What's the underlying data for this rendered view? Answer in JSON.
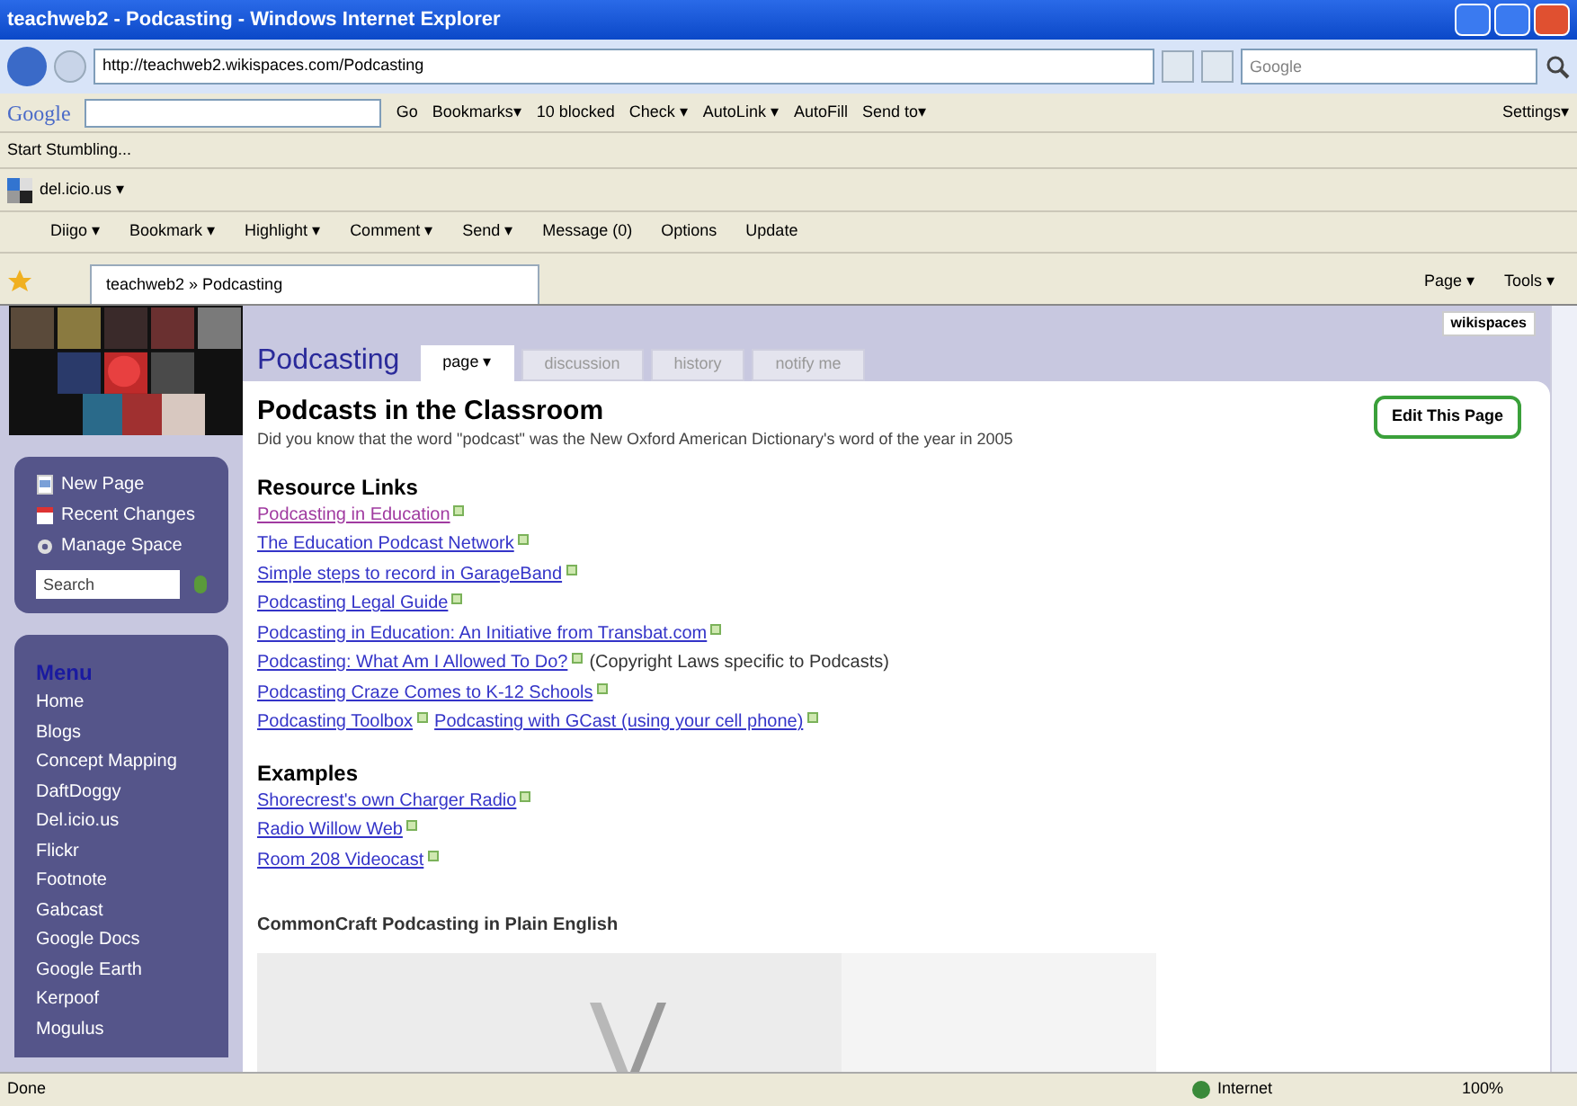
{
  "window": {
    "title": "teachweb2 - Podcasting - Windows Internet Explorer"
  },
  "address_bar": {
    "url": "http://teachweb2.wikispaces.com/Podcasting",
    "search_placeholder": "Google"
  },
  "google_toolbar": {
    "logo": "Google",
    "items": [
      "Go",
      "Bookmarks▾",
      "10 blocked",
      "Check ▾",
      "AutoLink ▾",
      "AutoFill",
      "Send to▾"
    ],
    "settings": "Settings▾"
  },
  "stumble_toolbar": {
    "label": "Start Stumbling..."
  },
  "delicious_toolbar": {
    "label": "del.icio.us ▾"
  },
  "diigo_toolbar": {
    "items": [
      "Diigo ▾",
      "Bookmark ▾",
      "Highlight ▾",
      "Comment ▾",
      "Send ▾",
      "Message (0)",
      "Options",
      "Update"
    ]
  },
  "browser_tab": {
    "label": "teachweb2 » Podcasting"
  },
  "command_bar": {
    "items": [
      "Page ▾",
      "Tools ▾"
    ]
  },
  "wiki": {
    "badge": "wikispaces",
    "page_title": "Podcasting",
    "tabs": [
      {
        "label": "page ▾",
        "selected": true
      },
      {
        "label": "discussion",
        "selected": false
      },
      {
        "label": "history",
        "selected": false
      },
      {
        "label": "notify me",
        "selected": false
      }
    ],
    "nav": [
      {
        "label": "New Page",
        "kind": "page"
      },
      {
        "label": "Recent Changes",
        "kind": "calendar"
      },
      {
        "label": "Manage Space",
        "kind": "gear"
      }
    ],
    "search_placeholder": "Search",
    "menu": {
      "heading": "Menu",
      "items": [
        "Home",
        "Blogs",
        "Concept Mapping",
        "DaftDoggy",
        "Del.icio.us",
        "Flickr",
        "Footnote",
        "Gabcast",
        "Google Docs",
        "Google Earth",
        "Kerpoof",
        "Mogulus"
      ]
    },
    "edit_button": "Edit This Page",
    "heading": "Podcasts in the Classroom",
    "intro": "Did you know that the word \"podcast\" was the New Oxford American Dictionary's word of the year in 2005",
    "sections": [
      {
        "title": "Resource Links",
        "links": [
          [
            {
              "kind": "link",
              "text": "Podcasting in Education",
              "visited": true
            }
          ],
          [
            {
              "kind": "link",
              "text": "The Education Podcast Network",
              "visited": false
            }
          ],
          [
            {
              "kind": "link",
              "text": "Simple steps to record in GarageBand",
              "visited": false
            }
          ],
          [
            {
              "kind": "link",
              "text": "Podcasting Legal Guide",
              "visited": false
            }
          ],
          [
            {
              "kind": "link",
              "text": "Podcasting in Education: An Initiative from Transbat.com",
              "visited": false
            }
          ],
          [
            {
              "kind": "link",
              "text": "Podcasting: What Am I Allowed To Do?",
              "visited": false
            },
            {
              "kind": "note",
              "text": "(Copyright Laws specific to Podcasts)"
            }
          ],
          [
            {
              "kind": "link",
              "text": "Podcasting Craze Comes to K-12 Schools",
              "visited": false
            }
          ],
          [
            {
              "kind": "link",
              "text": "Podcasting Toolbox",
              "visited": false
            },
            {
              "kind": "link",
              "text": "Podcasting with GCast (using your cell phone)",
              "visited": false
            }
          ]
        ]
      },
      {
        "title": "Examples",
        "links": [
          [
            {
              "kind": "link",
              "text": "Shorecrest's own Charger Radio",
              "visited": false
            }
          ],
          [
            {
              "kind": "link",
              "text": "Radio Willow Web",
              "visited": false
            }
          ],
          [
            {
              "kind": "link",
              "text": "Room 208 Videocast",
              "visited": false
            }
          ]
        ]
      }
    ],
    "video_title": "CommonCraft Podcasting in Plain English"
  },
  "status_bar": {
    "status": "Done",
    "zone": "Internet",
    "zoom": "100%"
  }
}
